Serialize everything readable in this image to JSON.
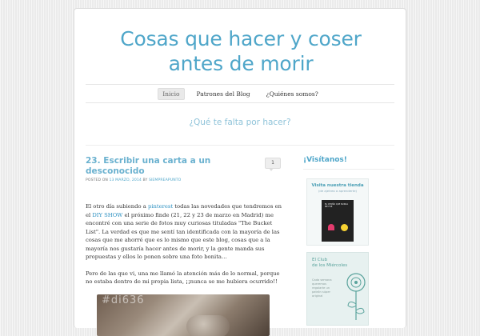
{
  "site": {
    "title": "Cosas que hacer y coser antes de morir",
    "tagline": "¿Qué te falta por hacer?"
  },
  "nav": {
    "items": [
      {
        "label": "Inicio",
        "active": true
      },
      {
        "label": "Patrones del Blog",
        "active": false
      },
      {
        "label": "¿Quiénes somos?",
        "active": false
      }
    ]
  },
  "post": {
    "number": "23.",
    "title": "Escribir una carta a un desconocido",
    "comment_count": "1",
    "meta": {
      "posted_on": "POSTED ON",
      "date": "13 MARZO, 2014",
      "by": "BY",
      "author": "SIEMPREAPUNTO"
    },
    "para1": {
      "t1": "El otro día subiendo a ",
      "link1": "pinterest",
      "t2": " todas las novedades que tendremos en el ",
      "link2": "DIY SHOW",
      "t3": " el próximo finde (21, 22 y 23 de marzo en Madrid) me encontré con una serie de fotos muy curiosas tituladas \"The Bucket List\". La verdad es que me sentí tan identificada con la mayoría de las cosas que me ahorré que es lo mismo que este blog, cosas que a la mayoría nos gustaría hacer antes de morir, y la gente manda sus propuestas y ellos lo ponen sobre una foto bonita…"
    },
    "para2": "Pero de las que vi, una me llamó la atención más de lo normal, porque no estaba dentro de mi propia lista, ¡¡nunca se me hubiera ocurrido!!",
    "image_text": "#di636"
  },
  "sidebar": {
    "title": "¡Visítanos!",
    "banner1": {
      "title": "Visita nuestra tienda",
      "subtitle": "(de ajetreo a aprenderte)",
      "book_text": "EL OTOÑO QUE NUNCA ME FUE"
    },
    "banner2": {
      "title": "El Club\nde los Miércoles",
      "body": "Cada semana queremos regalarte un patrón súper original"
    }
  },
  "colors": {
    "accent": "#4fa6c9",
    "background": "#ebebeb"
  }
}
